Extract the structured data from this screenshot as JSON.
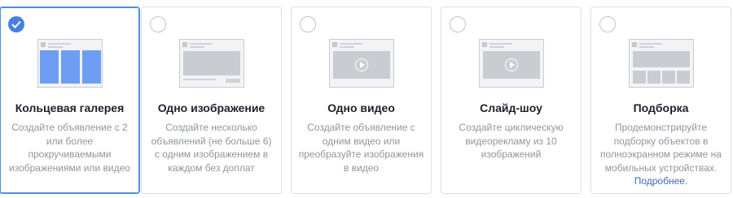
{
  "cards": [
    {
      "title": "Кольцевая галерея",
      "description": "Создайте объявление с 2 или более прокручиваемыми изображениями или видео",
      "selected": true
    },
    {
      "title": "Одно изображение",
      "description": "Создайте несколько объявлений (не больше 6) с одним изображением в каждом без доплат",
      "selected": false
    },
    {
      "title": "Одно видео",
      "description": "Создайте объявление с одним видео или преобразуйте изображения в видео",
      "selected": false
    },
    {
      "title": "Слайд-шоу",
      "description": "Создайте циклическую видеорекламу из 10 изображений",
      "selected": false
    },
    {
      "title": "Подборка",
      "description": "Продемонстрируйте подборку объектов в полноэкранном режиме на мобильных устройствах.",
      "link": "Подробнее.",
      "selected": false
    }
  ],
  "colors": {
    "accent": "#4a7fe0",
    "carousel_tile": "#6d9ef3",
    "link": "#4267b2"
  }
}
